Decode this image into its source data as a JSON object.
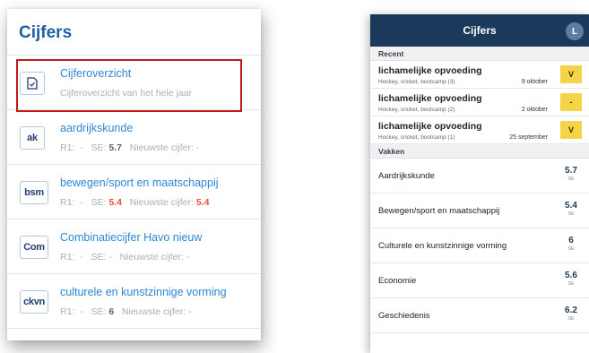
{
  "left_panel": {
    "title": "Cijfers",
    "items": [
      {
        "icon_name": "grade-overview-icon",
        "name": "Cijferoverzicht",
        "subtitle": "Cijferoverzicht van het hele jaar"
      },
      {
        "icon_text": "ak",
        "name": "aardrijkskunde",
        "r1_label": "R1:",
        "r1_value": "-",
        "se_label": "SE:",
        "se_value": "5.7",
        "latest_label": "Nieuwste cijfer:",
        "latest_value": "-"
      },
      {
        "icon_text": "bsm",
        "name": "bewegen/sport en maatschappij",
        "r1_label": "R1:",
        "r1_value": "-",
        "se_label": "SE:",
        "se_value": "5.4",
        "latest_label": "Nieuwste cijfer:",
        "latest_value": "5.4"
      },
      {
        "icon_text": "Com",
        "name": "Combinatiecijfer Havo nieuw",
        "r1_label": "R1:",
        "r1_value": "-",
        "se_label": "SE:",
        "se_value": "-",
        "latest_label": "Nieuwste cijfer:",
        "latest_value": "-"
      },
      {
        "icon_text": "ckvn",
        "name": "culturele en kunstzinnige vorming",
        "r1_label": "R1:",
        "r1_value": "-",
        "se_label": "SE:",
        "se_value": "6",
        "latest_label": "Nieuwste cijfer:",
        "latest_value": "-"
      }
    ]
  },
  "right_panel": {
    "title": "Cijfers",
    "avatar_initial": "L",
    "recent_label": "Recent",
    "recent": [
      {
        "title": "lichamelijke opvoeding",
        "subtitle": "Hockey, cricket, bootcamp (3)",
        "date": "9 oktober",
        "grade": "V"
      },
      {
        "title": "lichamelijke opvoeding",
        "subtitle": "Hockey, cricket, bootcamp (2)",
        "date": "2 oktober",
        "grade": "-"
      },
      {
        "title": "lichamelijke opvoeding",
        "subtitle": "Hockey, cricket, bootcamp (1)",
        "date": "25 september",
        "grade": "V"
      }
    ],
    "subjects_label": "Vakken",
    "subjects": [
      {
        "name": "Aardrijkskunde",
        "grade": "5.7",
        "type": "SE"
      },
      {
        "name": "Bewegen/sport en maatschappij",
        "grade": "5.4",
        "type": "SE"
      },
      {
        "name": "Culturele en kunstzinnige vorming",
        "grade": "6",
        "type": "SE"
      },
      {
        "name": "Economie",
        "grade": "5.6",
        "type": "SE"
      },
      {
        "name": "Geschiedenis",
        "grade": "6.2",
        "type": "SE"
      }
    ]
  },
  "colors": {
    "brand_blue": "#1f5fa6",
    "link_blue": "#2f86d0",
    "navy_bar": "#1b3a5b",
    "badge_yellow": "#f5d44a",
    "grade_red": "#e8503a",
    "highlight_red": "#c01a1a"
  }
}
